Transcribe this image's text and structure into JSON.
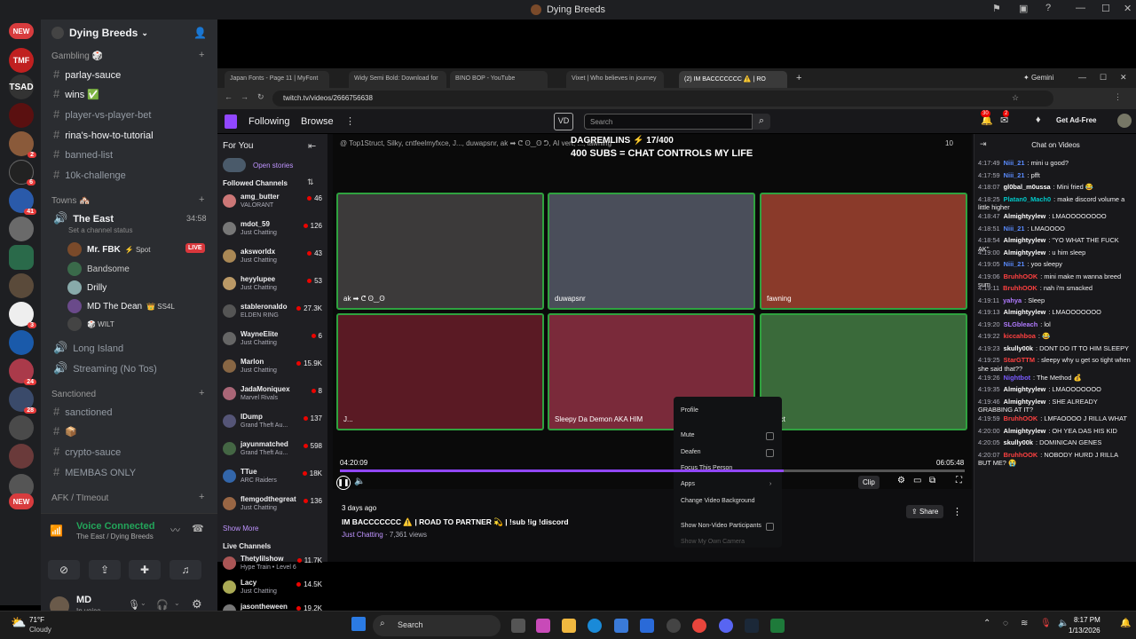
{
  "discord": {
    "window_title": "Dying Breeds",
    "server_name": "Dying Breeds",
    "servers": [
      {
        "label": "NEW",
        "color": "#d83c3e"
      },
      {
        "label": "TMF",
        "color": "#c02020"
      },
      {
        "label": "TSAD",
        "color": "#444"
      }
    ],
    "categories": {
      "gambling": "Gambling 🎲",
      "towns": "Towns 🏘️",
      "sanctioned": "Sanctioned",
      "afk": "AFK / TImeout"
    },
    "channels": {
      "parlay": "parlay-sauce",
      "wins": "wins ✅",
      "pvp": "player-vs-player-bet",
      "rina": "rina's-how-to-tutorial",
      "banned": "banned-list",
      "challenge": "10k-challenge",
      "sanctioned": "sanctioned",
      "box": "📦",
      "crypto": "crypto-sauce",
      "membas": "MEMBAS ONLY"
    },
    "voice": {
      "the_east": "The East",
      "timer": "34:58",
      "status_placeholder": "Set a channel status",
      "long_island": "Long Island",
      "streaming": "Streaming (No Tos)"
    },
    "voice_users": [
      {
        "name": "Mr. FBK",
        "tag": "⚡ Spot",
        "live": "LIVE",
        "color": "#7a4a2a"
      },
      {
        "name": "Bandsome",
        "tag": "",
        "color": "#3a6a4a"
      },
      {
        "name": "Drilly",
        "tag": "",
        "color": "#8aa"
      },
      {
        "name": "MD The Dean",
        "tag": "👑 SS4L",
        "color": "#6a4a8a"
      },
      {
        "name": "",
        "tag": "🎲 WILT",
        "color": "#444"
      }
    ],
    "voice_connected": "Voice Connected",
    "voice_location": "The East / Dying Breeds",
    "user": {
      "name": "MD",
      "status": "In voice"
    }
  },
  "browser": {
    "tabs": [
      "Japan Fonts - Page 11 | MyFont",
      "Widy Semi Bold: Download for",
      "BINO BOP - YouTube",
      "Vixet | Who believes in journey",
      "(2) IM BACCCCCCC ⚠️ | RO"
    ],
    "gemini": "Gemini",
    "url": "twitch.tv/videos/2666756638"
  },
  "twitch": {
    "nav": {
      "following": "Following",
      "browse": "Browse",
      "search_placeholder": "Search",
      "notif_count": "30",
      "inbox_count": "2",
      "ad_free": "Get Ad-Free"
    },
    "sidebar": {
      "for_you": "For You",
      "open_stories": "Open stories",
      "followed": "Followed Channels",
      "show_more": "Show More",
      "live": "Live Channels"
    },
    "followed": [
      {
        "name": "amg_butter",
        "game": "VALORANT",
        "viewers": "46",
        "color": "#c77"
      },
      {
        "name": "mdot_59",
        "game": "Just Chatting",
        "viewers": "126",
        "color": "#777"
      },
      {
        "name": "aksworldx",
        "game": "Just Chatting",
        "viewers": "43",
        "color": "#a85"
      },
      {
        "name": "heyylupee",
        "game": "Just Chatting",
        "viewers": "53",
        "color": "#b96"
      },
      {
        "name": "stableronaldo",
        "game": "ELDEN RING",
        "viewers": "27.3K",
        "color": "#555"
      },
      {
        "name": "WayneElite",
        "game": "Just Chatting",
        "viewers": "6",
        "color": "#666"
      },
      {
        "name": "Marlon",
        "game": "Just Chatting",
        "viewers": "15.9K",
        "color": "#864"
      },
      {
        "name": "JadaMoniquex",
        "game": "Marvel Rivals",
        "viewers": "8",
        "color": "#a67"
      },
      {
        "name": "IDump",
        "game": "Grand Theft Au...",
        "viewers": "137",
        "color": "#557"
      },
      {
        "name": "jayunmatched",
        "game": "Grand Theft Au...",
        "viewers": "598",
        "color": "#464"
      },
      {
        "name": "TTue",
        "game": "ARC Raiders",
        "viewers": "18K",
        "color": "#36a"
      },
      {
        "name": "flemgodthegreat",
        "game": "Just Chatting",
        "viewers": "136",
        "color": "#964"
      }
    ],
    "live_channels": [
      {
        "name": "Thetylilshow",
        "game": "Hype Train • Level 6",
        "viewers": "11.7K",
        "color": "#a55"
      },
      {
        "name": "Lacy",
        "game": "Just Chatting",
        "viewers": "14.5K",
        "color": "#aa5"
      },
      {
        "name": "jasontheween",
        "game": "Just Chatting",
        "viewers": "19.2K",
        "color": "#777"
      }
    ],
    "overlay_top": "@ Top1Struct, Silky, cntfeelmyfxce, J..., duwapsnr, ak ➡ ᕦ ʘ‿ʘ ᕤ, AI vert, ..., tawning",
    "overlay_title1": "DAGREMLINS ⚡ 17/400",
    "overlay_title2": "400 SUBS = CHAT CONTROLS MY LIFE",
    "overlay_viewers": "10",
    "tiles": [
      {
        "label": "ak ➡ ᕦ ʘ‿ʘ",
        "bg": "#3c3a3a"
      },
      {
        "label": "duwapsnr",
        "bg": "#4a4e5a"
      },
      {
        "label": "fawning",
        "bg": "#8a3a2a"
      },
      {
        "label": "J...",
        "bg": "#5a1a24"
      },
      {
        "label": "Sleepy Da Demon AKA HIM",
        "bg": "#7a2a3a"
      },
      {
        "label": "Struct",
        "bg": "#3a6a3a"
      }
    ],
    "context_menu": [
      "Profile",
      "Mute",
      "Deafen",
      "Focus This Person",
      "Apps",
      "Change Video Background",
      "Show Non-Video Participants",
      "Show My Own Camera"
    ],
    "time_elapsed": "04:20:09",
    "time_total": "06:05:48",
    "progress": 0.71,
    "clip": "Clip",
    "video": {
      "age": "3 days ago",
      "title": "IM BACCCCCCC ⚠️ | ROAD TO PARTNER 💫 | !sub !ig !discord",
      "category": "Just Chatting",
      "views": "7,361 views",
      "share": "Share"
    },
    "chat_title": "Chat on Videos",
    "chat": [
      {
        "t": "4:17:49",
        "u": "Niii_21",
        "c": "#5a8cff",
        "m": "mini u good?"
      },
      {
        "t": "4:17:59",
        "u": "Niii_21",
        "c": "#5a8cff",
        "m": "pfft"
      },
      {
        "t": "4:18:07",
        "u": "gl0bal_m0ussa",
        "c": "#ffffff",
        "m": "Mini fried 😂"
      },
      {
        "t": "4:18:25",
        "u": "Platan0_Mach0",
        "c": "#00c8c8",
        "m": "make discord volume a little higher"
      },
      {
        "t": "4:18:47",
        "u": "Almightyylew",
        "c": "#ffffff",
        "m": "LMAOOOOOOOO"
      },
      {
        "t": "4:18:51",
        "u": "Niii_21",
        "c": "#5a8cff",
        "m": "LMAOOOO"
      },
      {
        "t": "4:18:54",
        "u": "Almightyylew",
        "c": "#ffffff",
        "m": "\"YO WHAT THE FUCK AK\""
      },
      {
        "t": "4:19:00",
        "u": "Almightyylew",
        "c": "#ffffff",
        "m": "u him sleep"
      },
      {
        "t": "4:19:05",
        "u": "Niii_21",
        "c": "#5a8cff",
        "m": "yoo sleepy"
      },
      {
        "t": "4:19:06",
        "u": "BruhhOOK",
        "c": "#ff4040",
        "m": "mini make m wanna breed sum"
      },
      {
        "t": "4:19:11",
        "u": "BruhhOOK",
        "c": "#ff4040",
        "m": "nah i'm smacked"
      },
      {
        "t": "4:19:11",
        "u": "yahya",
        "c": "#b07aff",
        "m": "Sleep"
      },
      {
        "t": "4:19:13",
        "u": "Almightyylew",
        "c": "#ffffff",
        "m": "LMAOOOOOOO"
      },
      {
        "t": "4:19:20",
        "u": "SLGbleach",
        "c": "#b07aff",
        "m": "lol"
      },
      {
        "t": "4:19:22",
        "u": "kiccahboa",
        "c": "#ff4040",
        "m": "😂"
      },
      {
        "t": "4:19:23",
        "u": "skully00k",
        "c": "#ffffff",
        "m": "DONT DO IT TO HIM SLEEPY"
      },
      {
        "t": "4:19:25",
        "u": "StarGTTM",
        "c": "#ff4040",
        "m": "sleepy why u get so tight when she said that??"
      },
      {
        "t": "4:19:26",
        "u": "Nightbot",
        "c": "#7a5aff",
        "m": "The Method 💰"
      },
      {
        "t": "4:19:35",
        "u": "Almightyylew",
        "c": "#ffffff",
        "m": "LMAOOOOOOO"
      },
      {
        "t": "4:19:46",
        "u": "Almightyylew",
        "c": "#ffffff",
        "m": "SHE ALREADY GRABBING AT IT?"
      },
      {
        "t": "4:19:59",
        "u": "BruhhOOK",
        "c": "#ff4040",
        "m": "LMFAOOOO J RILLA WHAT"
      },
      {
        "t": "4:20:00",
        "u": "Almightyylew",
        "c": "#ffffff",
        "m": "OH YEA DAS HIS KID"
      },
      {
        "t": "4:20:05",
        "u": "skully00k",
        "c": "#ffffff",
        "m": "DOMINICAN GENES"
      },
      {
        "t": "4:20:07",
        "u": "BruhhOOK",
        "c": "#ff4040",
        "m": "NOBODY HURD J RILLA BUT ME? 😭"
      }
    ]
  },
  "taskbar": {
    "weather_temp": "71°F",
    "weather_desc": "Cloudy",
    "search": "Search",
    "time": "8:17 PM",
    "date": "1/13/2026"
  }
}
